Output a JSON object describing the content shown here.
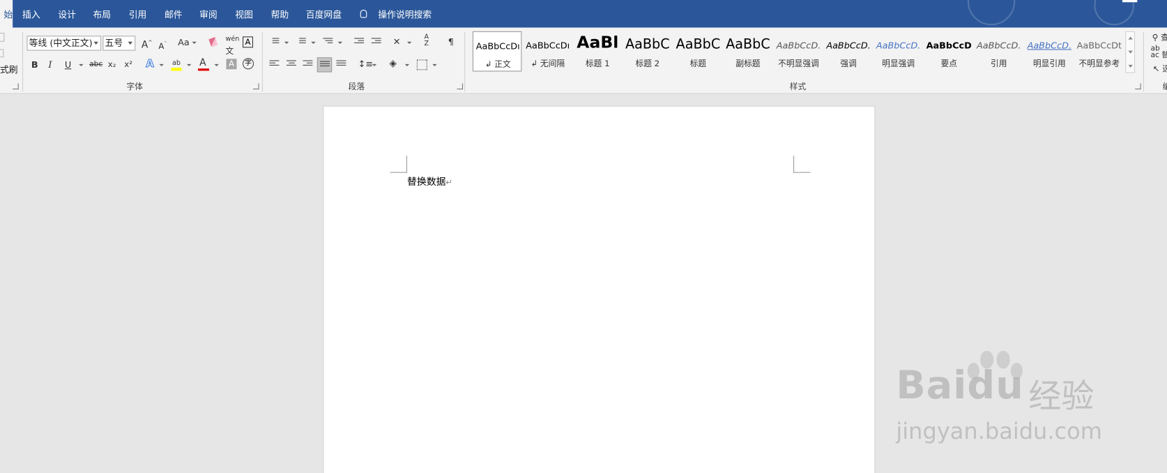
{
  "tabs": [
    {
      "label": "始",
      "active": true
    },
    {
      "label": "插入"
    },
    {
      "label": "设计"
    },
    {
      "label": "布局"
    },
    {
      "label": "引用"
    },
    {
      "label": "邮件"
    },
    {
      "label": "审阅"
    },
    {
      "label": "视图"
    },
    {
      "label": "帮助"
    },
    {
      "label": "百度网盘"
    }
  ],
  "tell_me": "操作说明搜索",
  "clipboard": {
    "format_painter_label": "式刷"
  },
  "font": {
    "family": "等线 (中文正文)",
    "size": "五号",
    "change_case": "Aa",
    "phonetic": "wén",
    "bold": "B",
    "italic": "I",
    "underline": "U",
    "strike": "abc",
    "subscript": "x₂",
    "superscript": "x²",
    "text_effects": "A",
    "font_color": "A",
    "char_shading": "A",
    "enclose": "字",
    "group_label": "字体"
  },
  "paragraph": {
    "group_label": "段落"
  },
  "styles": {
    "group_label": "样式",
    "items": [
      {
        "preview": "AaBbCcDı",
        "name": "↲ 正文"
      },
      {
        "preview": "AaBbCcDı",
        "name": "↲ 无间隔"
      },
      {
        "preview": "AaBl",
        "name": "标题 1"
      },
      {
        "preview": "AaBbC",
        "name": "标题 2"
      },
      {
        "preview": "AaBbC",
        "name": "标题"
      },
      {
        "preview": "AaBbC",
        "name": "副标题"
      },
      {
        "preview": "AaBbCcD.",
        "name": "不明显强调"
      },
      {
        "preview": "AaBbCcD.",
        "name": "强调"
      },
      {
        "preview": "AaBbCcD.",
        "name": "明显强调"
      },
      {
        "preview": "AaBbCcD",
        "name": "要点"
      },
      {
        "preview": "AaBbCcD.",
        "name": "引用"
      },
      {
        "preview": "AaBbCcD.",
        "name": "明显引用"
      },
      {
        "preview": "AaBbCcDt",
        "name": "不明显参考"
      }
    ]
  },
  "editing": {
    "find_label": "查",
    "replace_label": "替",
    "select_label": "选",
    "group_label": "编"
  },
  "document": {
    "body_text": "替换数据",
    "paragraph_mark": "↵"
  },
  "watermark": {
    "brand": "Bai",
    "brand_suffix": "du",
    "cn": "经验",
    "url": "jingyan.baidu.com"
  },
  "colors": {
    "ribbon_tab_bar": "#2b579a",
    "highlight": "#ffff00",
    "font_color_bar": "#e00000"
  }
}
